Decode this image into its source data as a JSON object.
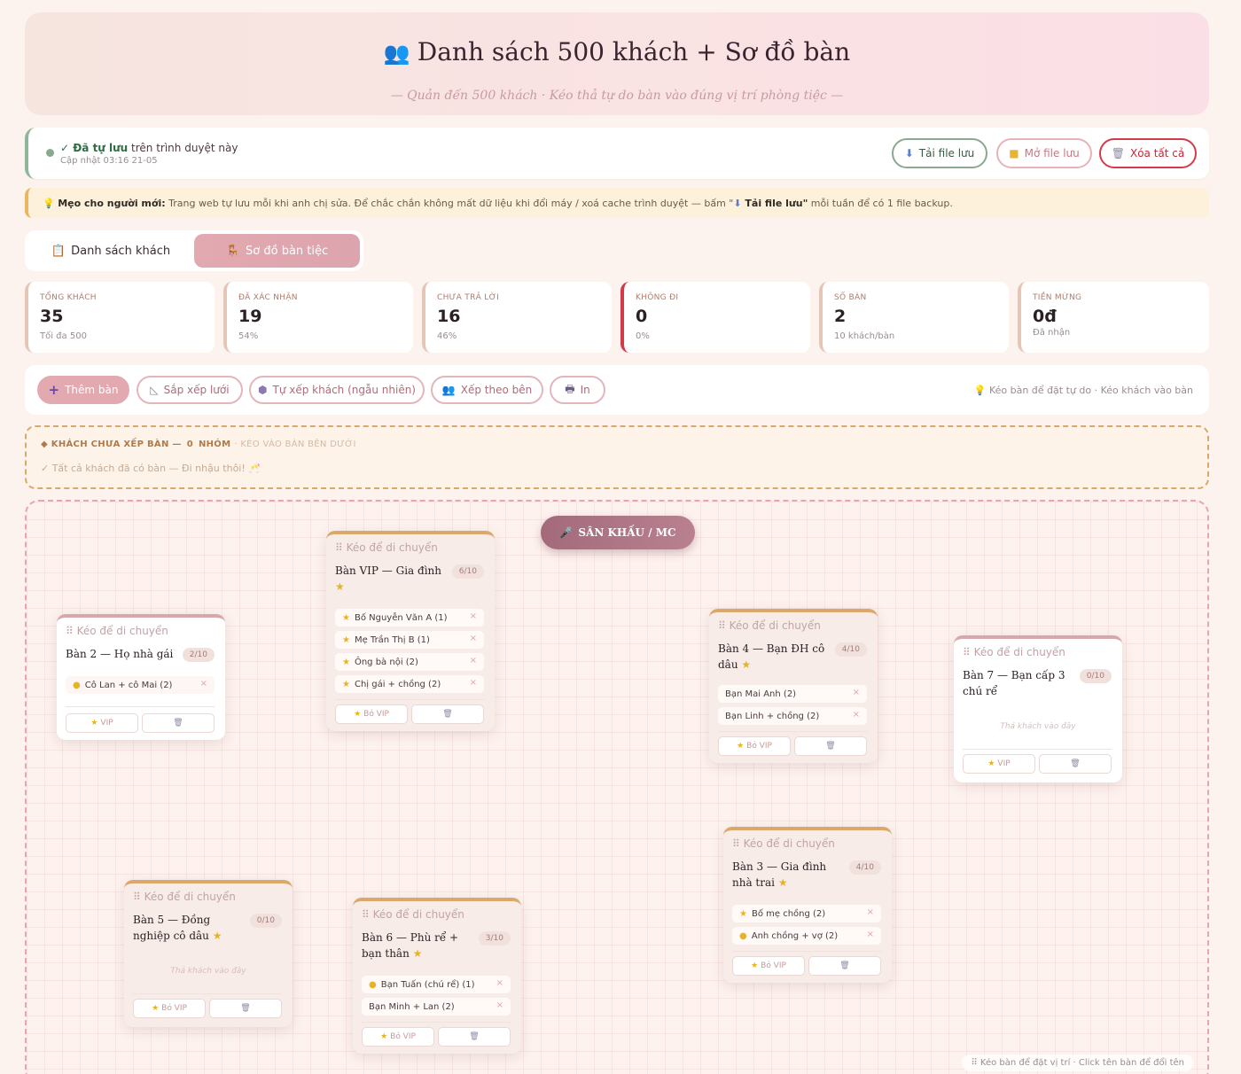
{
  "header": {
    "icon": "people-icon",
    "title": "Danh sách 500 khách + Sơ đồ bàn",
    "subtitle": "— Quản đến 500 khách · Kéo thả tự do bàn vào đúng vị trí phòng tiệc —"
  },
  "save": {
    "status_bold": "✓ Đã tự lưu",
    "status_rest": " trên trình duyệt này",
    "updated": "Cập nhật 03:16 21-05",
    "download_label": "Tải file lưu",
    "open_label": "Mở file lưu",
    "clear_label": "Xóa tất cả"
  },
  "tip": {
    "bold": "Mẹo cho người mới:",
    "text": " Trang web tự lưu mỗi khi anh chị sửa. Để chắc chắn không mất dữ liệu khi đổi máy / xoá cache trình duyệt — bấm \"",
    "bold2": " Tải file lưu\"",
    "text2": " mỗi tuần để có 1 file backup."
  },
  "tabs": {
    "guests": "Danh sách khách",
    "seating": "Sơ đồ bàn tiệc"
  },
  "stats": [
    {
      "label": "TỔNG KHÁCH",
      "value": "35",
      "sub": "Tối đa 500"
    },
    {
      "label": "ĐÃ XÁC NHẬN",
      "value": "19",
      "sub": "54%"
    },
    {
      "label": "CHƯA TRẢ LỜI",
      "value": "16",
      "sub": "46%"
    },
    {
      "label": "KHÔNG ĐI",
      "value": "0",
      "sub": "0%"
    },
    {
      "label": "SỐ BÀN",
      "value": "2",
      "sub": "10 khách/bàn"
    },
    {
      "label": "TIỀN MỪNG",
      "value": "0đ",
      "sub": "Đã nhận"
    }
  ],
  "toolbar": {
    "add": "Thêm bàn",
    "grid": "Sắp xếp lưới",
    "auto": "Tự xếp khách (ngẫu nhiên)",
    "side": "Xếp theo bên",
    "print": "In",
    "hint": "Kéo bàn để đặt tự do · Kéo khách vào bàn"
  },
  "unassigned": {
    "title": "KHÁCH CHƯA XẾP BÀN —",
    "count": "0",
    "unit": "NHÓM",
    "hint": "· KÉO VÀO BÀN BÊN DƯỚI",
    "empty": "✓ Tất cả khách đã có bàn — Đi nhậu thôi! 🥂"
  },
  "floor": {
    "stage": "SÂN KHẤU / MC",
    "hint": "⠿ Kéo bàn để đặt vị trí · Click tên bàn để đổi tên",
    "drag_label": "Kéo để di chuyển",
    "empty_label": "Thả khách vào đây",
    "vip_label": "VIP",
    "unvip_label": "Bỏ VIP"
  },
  "tables": [
    {
      "id": "t2",
      "name": "Bàn 2 — Họ nhà gái",
      "star": false,
      "count": "2/10",
      "vip": false,
      "guests": [
        {
          "name": "Cô Lan + cô Mai (2)",
          "icon": "dot"
        }
      ]
    },
    {
      "id": "tvip",
      "name": "Bàn VIP — Gia đình",
      "star": true,
      "count": "6/10",
      "vip": true,
      "guests": [
        {
          "name": "Bố Nguyễn Văn A (1)",
          "icon": "star"
        },
        {
          "name": "Mẹ Trần Thị B (1)",
          "icon": "star"
        },
        {
          "name": "Ông bà nội (2)",
          "icon": "star"
        },
        {
          "name": "Chị gái + chồng (2)",
          "icon": "star"
        }
      ]
    },
    {
      "id": "t4",
      "name": "Bàn 4 — Bạn ĐH cô dâu",
      "star": true,
      "count": "4/10",
      "vip": true,
      "guests": [
        {
          "name": "Bạn Mai Anh (2)",
          "icon": ""
        },
        {
          "name": "Bạn Linh + chồng (2)",
          "icon": ""
        }
      ]
    },
    {
      "id": "t7",
      "name": "Bàn 7 — Bạn cấp 3 chú rể",
      "star": false,
      "count": "0/10",
      "vip": false,
      "guests": []
    },
    {
      "id": "t3",
      "name": "Bàn 3 — Gia đình nhà trai",
      "star": true,
      "count": "4/10",
      "vip": true,
      "guests": [
        {
          "name": "Bố mẹ chồng (2)",
          "icon": "star"
        },
        {
          "name": "Anh chồng + vợ (2)",
          "icon": "dot"
        }
      ]
    },
    {
      "id": "t5",
      "name": "Bàn 5 — Đồng nghiệp cô dâu",
      "star": true,
      "count": "0/10",
      "vip": true,
      "guests": []
    },
    {
      "id": "t6",
      "name": "Bàn 6 — Phù rể + bạn thân",
      "star": true,
      "count": "3/10",
      "vip": true,
      "guests": [
        {
          "name": "Bạn Tuấn (chú rể) (1)",
          "icon": "dot"
        },
        {
          "name": "Bạn Minh + Lan (2)",
          "icon": ""
        }
      ]
    }
  ]
}
